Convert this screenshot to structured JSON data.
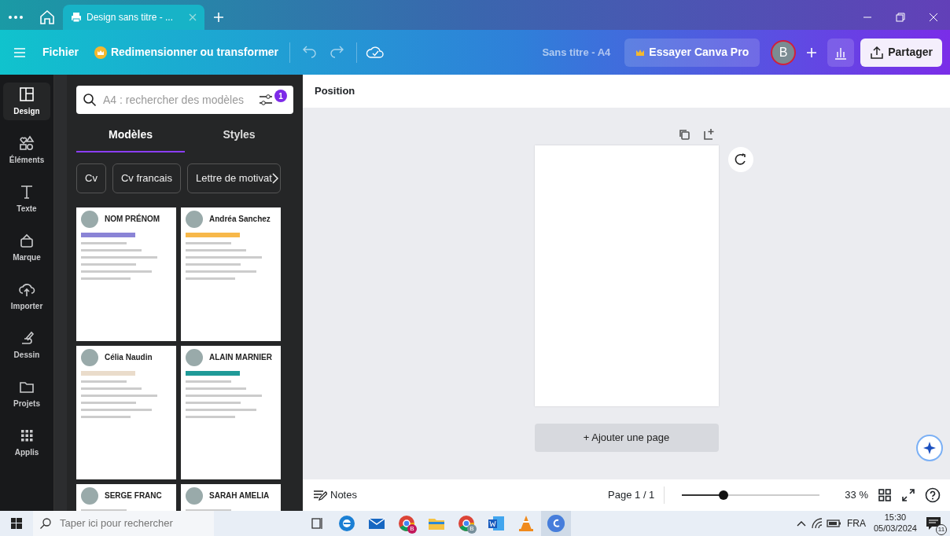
{
  "browser_tabs": [
    {
      "label": "Design sans titre - ...",
      "selected": true
    }
  ],
  "toolbar": {
    "file": "Fichier",
    "resize": "Redimensionner ou transformer",
    "doc_title": "Sans titre - A4",
    "pro": "Essayer Canva Pro",
    "avatar": "B",
    "share": "Partager"
  },
  "rail": [
    {
      "label": "Design",
      "kind": "layout",
      "selected": true
    },
    {
      "label": "Éléments",
      "kind": "shapes",
      "selected": false
    },
    {
      "label": "Texte",
      "kind": "text",
      "selected": false
    },
    {
      "label": "Marque",
      "kind": "brand",
      "selected": false
    },
    {
      "label": "Importer",
      "kind": "upload",
      "selected": false
    },
    {
      "label": "Dessin",
      "kind": "draw",
      "selected": false
    },
    {
      "label": "Projets",
      "kind": "folder",
      "selected": false
    },
    {
      "label": "Applis",
      "kind": "grid",
      "selected": false
    }
  ],
  "search": {
    "placeholder": "A4 : rechercher des modèles",
    "filter_count": "1"
  },
  "panel_tabs": [
    {
      "label": "Modèles",
      "selected": true
    },
    {
      "label": "Styles",
      "selected": false
    }
  ],
  "chips": [
    "Cv",
    "Cv francais",
    "Lettre de motivat"
  ],
  "templates": [
    {
      "name": "NOM PRÉNOM",
      "color": "#8a84d6"
    },
    {
      "name": "Andréa Sanchez",
      "color": "#f7b84a"
    },
    {
      "name": "Célia Naudin",
      "color": "#eadccb"
    },
    {
      "name": "ALAIN MARNIER",
      "color": "#1f9a98"
    },
    {
      "name": "SERGE FRANC"
    },
    {
      "name": "SARAH AMELIA"
    }
  ],
  "context_bar": {
    "label": "Position"
  },
  "add_page": "+ Ajouter une page",
  "bottom_bar": {
    "notes": "Notes",
    "page": "Page 1 / 1",
    "zoom": {
      "level": 0.3
    },
    "zoom_reading": "33 %"
  },
  "taskbar": {
    "search_placeholder": "Taper ici pour rechercher",
    "apps": [
      {
        "kind": "edge"
      },
      {
        "kind": "mail"
      },
      {
        "kind": "chrome",
        "badge": "B",
        "color": "#c2185b"
      },
      {
        "kind": "folder"
      },
      {
        "kind": "chrome",
        "badge": "B",
        "color": "#78909c"
      },
      {
        "kind": "word"
      },
      {
        "kind": "vlc"
      },
      {
        "kind": "canva",
        "selected": true
      }
    ],
    "language": "FRA",
    "time": "15:30",
    "date": "05/03/2024",
    "notifications": "11"
  }
}
